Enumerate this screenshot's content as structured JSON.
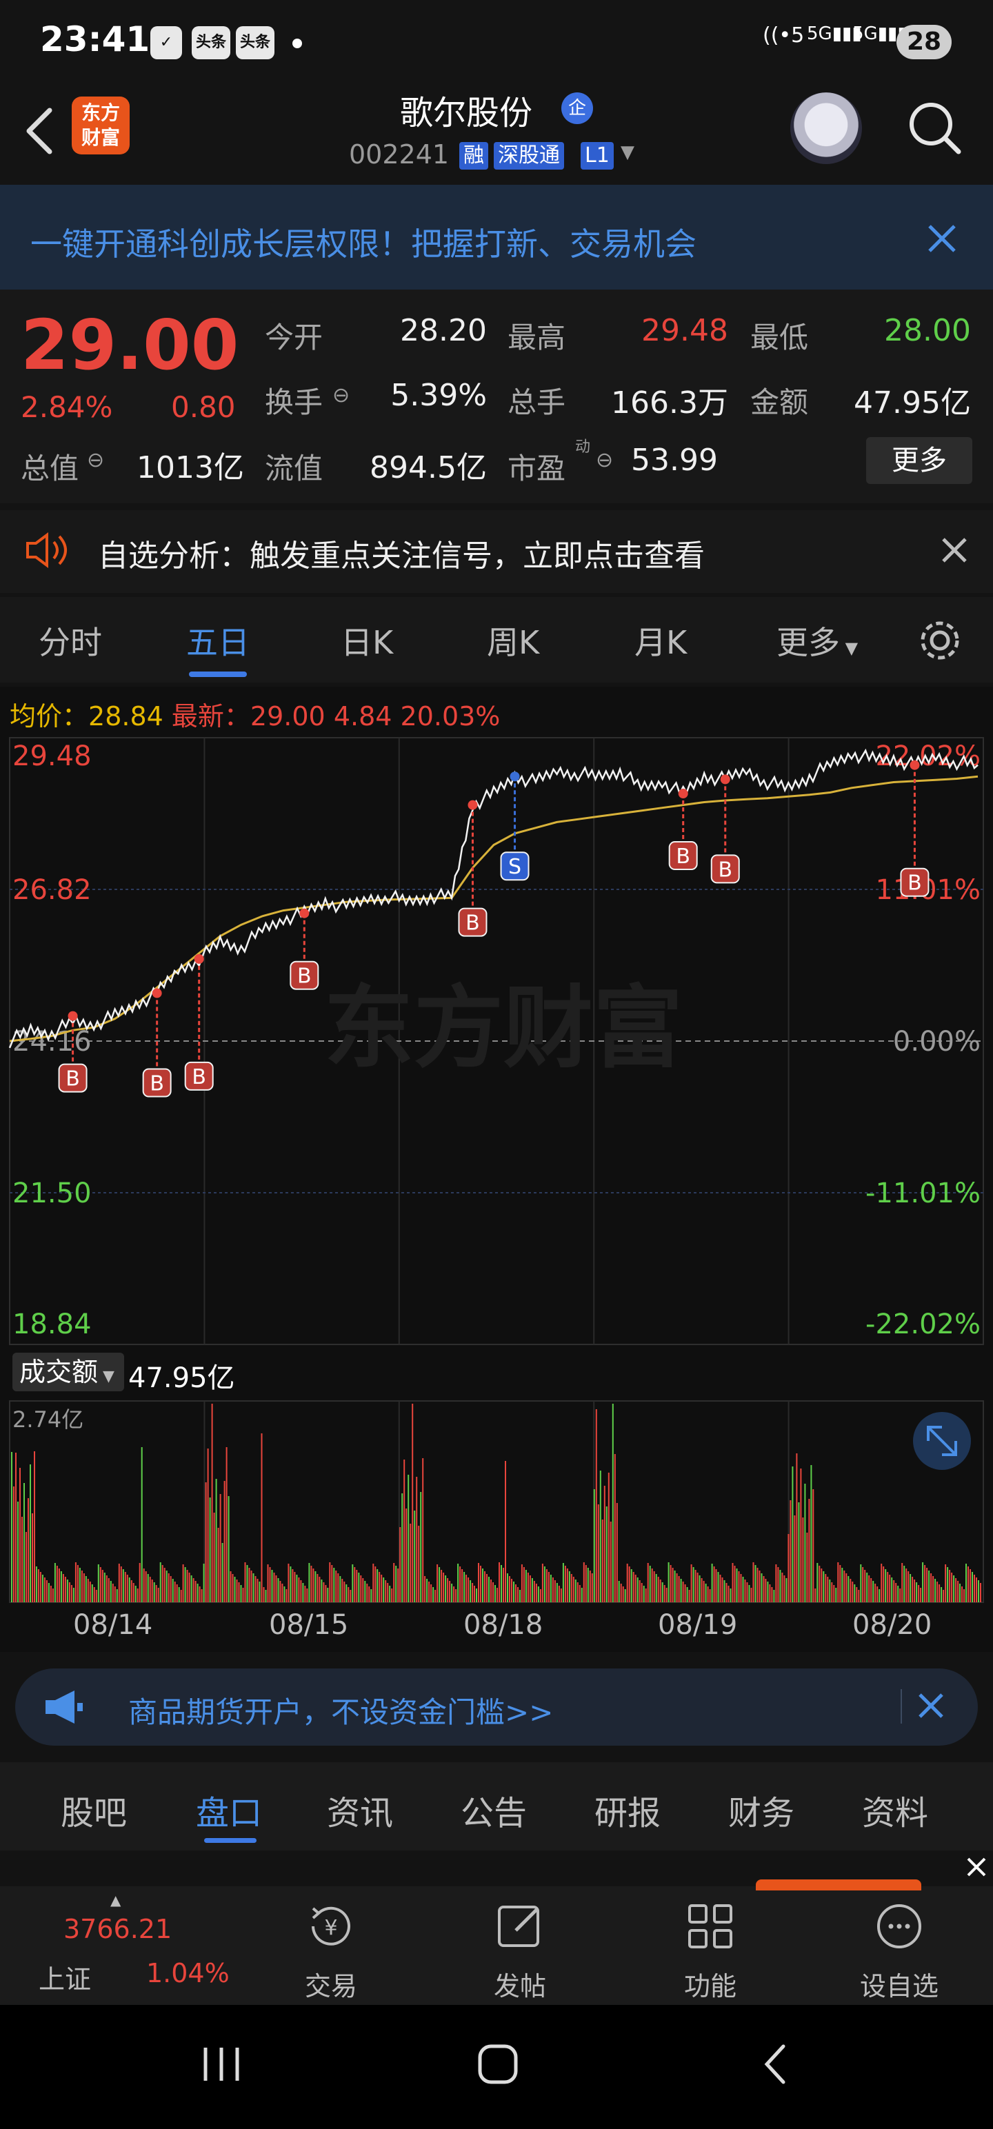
{
  "status_bar": {
    "time": "23:41",
    "app_icons": [
      "头条",
      "头条"
    ],
    "net1": "5",
    "net2": "5G",
    "net3": "5G",
    "battery": "28"
  },
  "header": {
    "logo_line1": "东方",
    "logo_line2": "财富",
    "stock_name": "歌尔股份",
    "qiye_badge": "企",
    "stock_code": "002241",
    "badges": [
      "融",
      "深股通",
      "L1"
    ]
  },
  "promo": {
    "text": "一键开通科创成长层权限！把握打新、交易机会"
  },
  "quote": {
    "price": "29.00",
    "pct": "2.84%",
    "change": "0.80",
    "open_label": "今开",
    "open": "28.20",
    "high_label": "最高",
    "high": "29.48",
    "low_label": "最低",
    "low": "28.00",
    "turnover_label": "换手",
    "turnover": "5.39%",
    "volume_label": "总手",
    "volume": "166.3万",
    "amount_label": "金额",
    "amount": "47.95亿",
    "mktcap_label": "总值",
    "mktcap": "1013亿",
    "float_label": "流值",
    "float": "894.5亿",
    "pe_label": "市盈",
    "pe_sup": "动",
    "pe": "53.99",
    "more": "更多"
  },
  "analysis": {
    "text": "自选分析：触发重点关注信号，立即点击查看"
  },
  "tabs": [
    "分时",
    "五日",
    "日K",
    "周K",
    "月K",
    "更多"
  ],
  "chart_legend": {
    "avg_label": "均价：",
    "avg": "28.84",
    "latest_label": "最新：",
    "latest": "29.00",
    "chg": "4.84",
    "pct": "20.03%"
  },
  "chart_data": {
    "type": "line",
    "y_left_ticks": [
      "29.48",
      "26.82",
      "24.16",
      "21.50",
      "18.84"
    ],
    "y_right_ticks": [
      "22.02%",
      "11.01%",
      "0.00%",
      "-11.01%",
      "-22.02%"
    ],
    "x_labels": [
      "08/14",
      "08/15",
      "08/18",
      "08/19",
      "08/20"
    ],
    "ylim": [
      18.84,
      29.48
    ],
    "baseline": 24.16,
    "watermark": "东方财富",
    "price_series": [
      24.16,
      24.35,
      24.3,
      24.5,
      24.45,
      24.6,
      24.8,
      25.0,
      25.4,
      25.6,
      25.9,
      25.8,
      26.1,
      26.3,
      26.4,
      26.6,
      26.5,
      26.65,
      26.7,
      26.6,
      26.7,
      26.7,
      28.3,
      28.5,
      28.8,
      28.7,
      28.9,
      28.85,
      28.8,
      28.9,
      28.6,
      28.7,
      28.5,
      28.8,
      28.75,
      28.9,
      28.7,
      28.6,
      28.8,
      29.0,
      29.2,
      29.1,
      29.1,
      29.0,
      29.15,
      29.05,
      29.0
    ],
    "avg_series": [
      24.16,
      24.2,
      24.25,
      24.35,
      24.4,
      24.55,
      24.8,
      25.1,
      25.4,
      25.7,
      26.0,
      26.2,
      26.35,
      26.45,
      26.5,
      26.55,
      26.6,
      26.62,
      26.64,
      26.65,
      26.66,
      26.67,
      27.2,
      27.6,
      27.8,
      27.9,
      28.0,
      28.05,
      28.1,
      28.15,
      28.2,
      28.25,
      28.3,
      28.35,
      28.38,
      28.4,
      28.42,
      28.45,
      28.48,
      28.52,
      28.6,
      28.65,
      28.7,
      28.72,
      28.74,
      28.76,
      28.8
    ],
    "markers": [
      {
        "type": "B",
        "series_x": 3,
        "price": 24.6
      },
      {
        "type": "B",
        "series_x": 7,
        "price": 25.0
      },
      {
        "type": "B",
        "series_x": 9,
        "price": 25.6
      },
      {
        "type": "B",
        "series_x": 14,
        "price": 26.4
      },
      {
        "type": "S",
        "series_x": 24,
        "price": 28.8
      },
      {
        "type": "B",
        "series_x": 22,
        "price": 28.3
      },
      {
        "type": "B",
        "series_x": 32,
        "price": 28.5
      },
      {
        "type": "B",
        "series_x": 34,
        "price": 28.75
      },
      {
        "type": "B",
        "series_x": 43,
        "price": 29.0
      }
    ],
    "volume": {
      "label": "成交额",
      "value": "47.95亿",
      "max_label": "2.74亿"
    }
  },
  "banner": {
    "text": "商品期货开户，不设资金门槛>>"
  },
  "bottom_tabs": [
    "股吧",
    "盘口",
    "资讯",
    "公告",
    "研报",
    "财务",
    "资料"
  ],
  "bottom_bar": {
    "index_value": "3766.21",
    "index_name": "上证",
    "index_pct": "1.04%",
    "items": [
      "交易",
      "发帖",
      "功能",
      "设自选"
    ]
  }
}
